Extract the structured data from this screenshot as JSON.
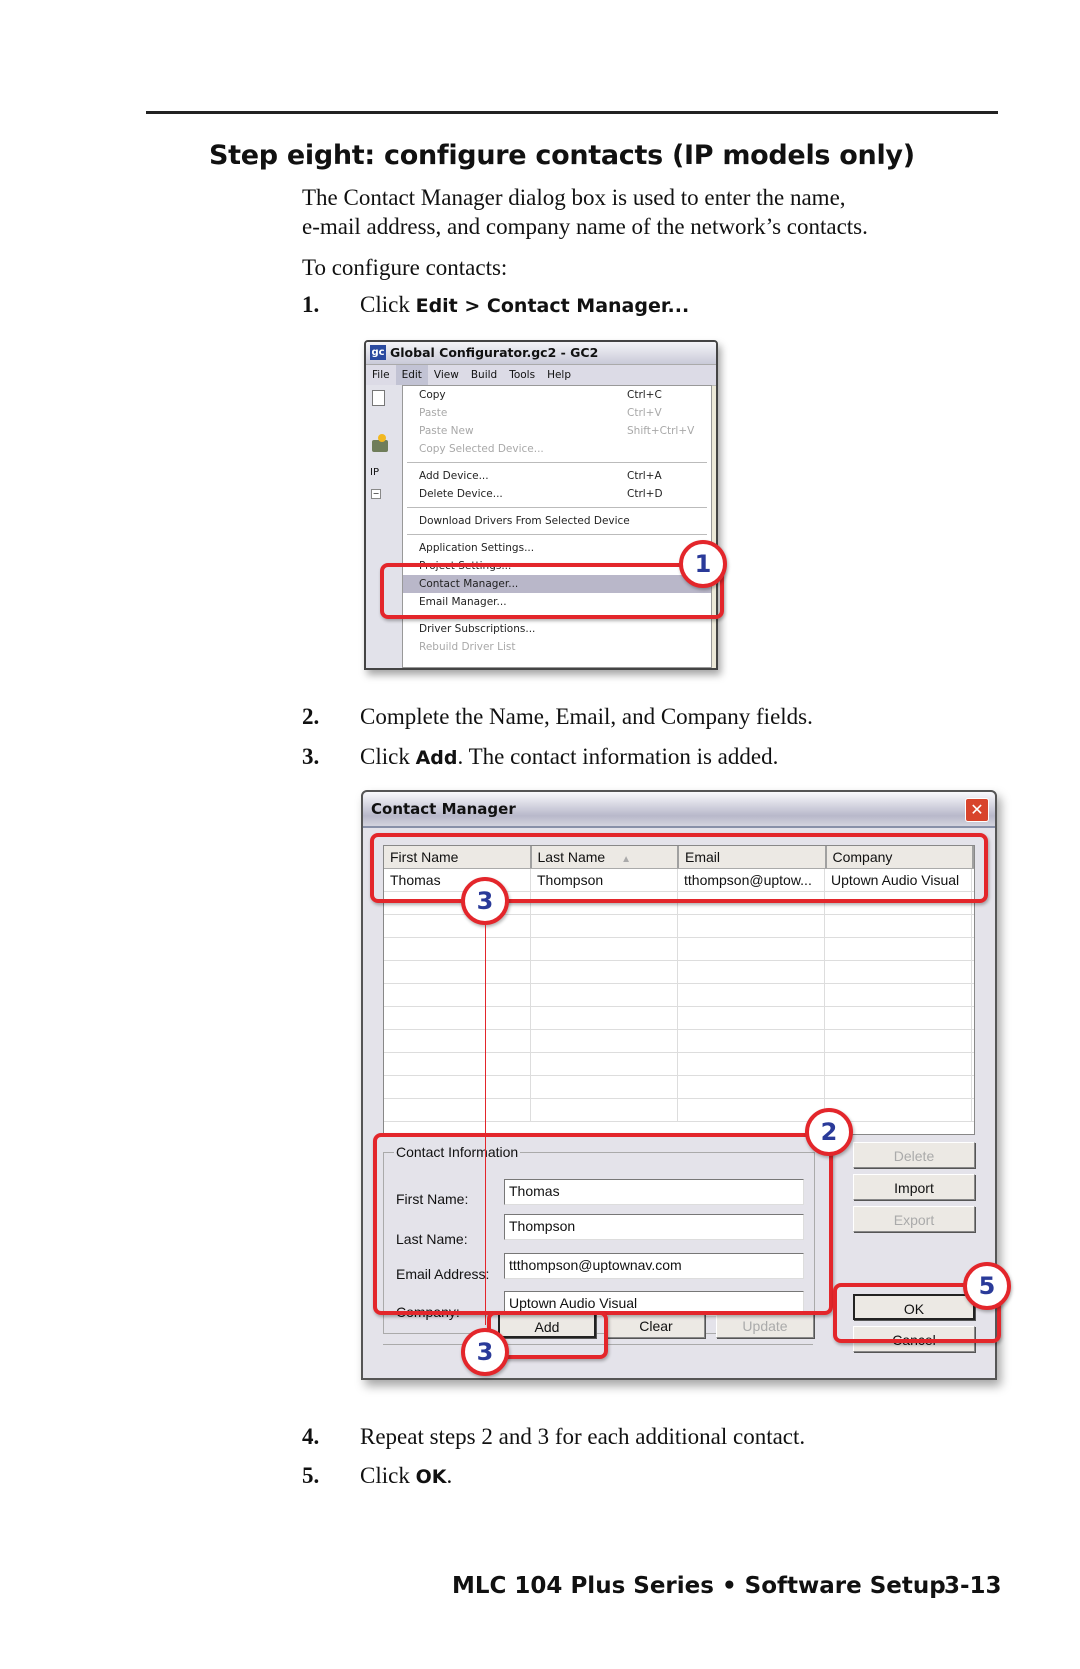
{
  "page": {
    "heading": "Step eight: configure contacts (IP models only)",
    "intro_line1": "The Contact Manager dialog box is used to enter the name,",
    "intro_line2": "e-mail address, and company name of the network’s contacts.",
    "to_configure": "To configure contacts:",
    "steps": [
      {
        "num": "1.",
        "prefix": "Click ",
        "bold": "Edit > Contact Manager...",
        "suffix": ""
      },
      {
        "num": "2.",
        "prefix": "Complete the Name, Email, and Company fields.",
        "bold": "",
        "suffix": ""
      },
      {
        "num": "3.",
        "prefix": "Click ",
        "bold": "Add",
        "suffix": ".  The contact information is added."
      },
      {
        "num": "4.",
        "prefix": "Repeat steps 2 and 3 for each additional contact.",
        "bold": "",
        "suffix": ""
      },
      {
        "num": "5.",
        "prefix": "Click ",
        "bold": "OK",
        "suffix": "."
      }
    ],
    "footer": {
      "title": "MLC 104 Plus Series • Software Setup",
      "page_number": "3-13"
    }
  },
  "menu_screenshot": {
    "window_title": "Global Configurator.gc2 - GC2",
    "logo_text": "gc",
    "menubar": [
      "File",
      "Edit",
      "View",
      "Build",
      "Tools",
      "Help"
    ],
    "side_tab": "IP",
    "items": [
      {
        "label": "Copy",
        "shortcut": "Ctrl+C",
        "disabled": false
      },
      {
        "label": "Paste",
        "shortcut": "Ctrl+V",
        "disabled": true
      },
      {
        "label": "Paste New",
        "shortcut": "Shift+Ctrl+V",
        "disabled": true
      },
      {
        "label": "Copy Selected Device...",
        "shortcut": "",
        "disabled": true
      },
      {
        "label": "Add Device...",
        "shortcut": "Ctrl+A",
        "disabled": false
      },
      {
        "label": "Delete Device...",
        "shortcut": "Ctrl+D",
        "disabled": false
      },
      {
        "label": "Download Drivers From Selected Device",
        "shortcut": "",
        "disabled": false
      },
      {
        "label": "Application Settings...",
        "shortcut": "",
        "disabled": false
      },
      {
        "label": "Project Settings...",
        "shortcut": "",
        "disabled": false
      },
      {
        "label": "Contact Manager...",
        "shortcut": "",
        "disabled": false,
        "highlighted": true
      },
      {
        "label": "Email Manager...",
        "shortcut": "",
        "disabled": false
      },
      {
        "label": "Driver Subscriptions...",
        "shortcut": "",
        "disabled": false
      },
      {
        "label": "Rebuild Driver List",
        "shortcut": "",
        "disabled": true
      }
    ],
    "callout": "1"
  },
  "dialog": {
    "title": "Contact Manager",
    "close_glyph": "✕",
    "columns": [
      "First Name",
      "Last Name",
      "Email",
      "Company"
    ],
    "sort_glyph": "▲",
    "rows": [
      [
        "Thomas",
        "Thompson",
        "tthompson@uptow...",
        "Uptown Audio Visual"
      ]
    ],
    "group_label": "Contact Information",
    "fields": [
      {
        "label": "First Name:",
        "value": "Thomas"
      },
      {
        "label": "Last Name:",
        "value": "Thompson"
      },
      {
        "label": "Email Address:",
        "value": "ttthompson@uptownav.com"
      },
      {
        "label": "Company:",
        "value": "Uptown Audio Visual"
      }
    ],
    "buttons": {
      "add": "Add",
      "clear": "Clear",
      "update": "Update",
      "delete": "Delete",
      "import": "Import",
      "export": "Export",
      "ok": "OK",
      "cancel": "Cancel"
    },
    "callouts": {
      "table": "3",
      "fields": "2",
      "add": "3",
      "ok": "5"
    }
  }
}
